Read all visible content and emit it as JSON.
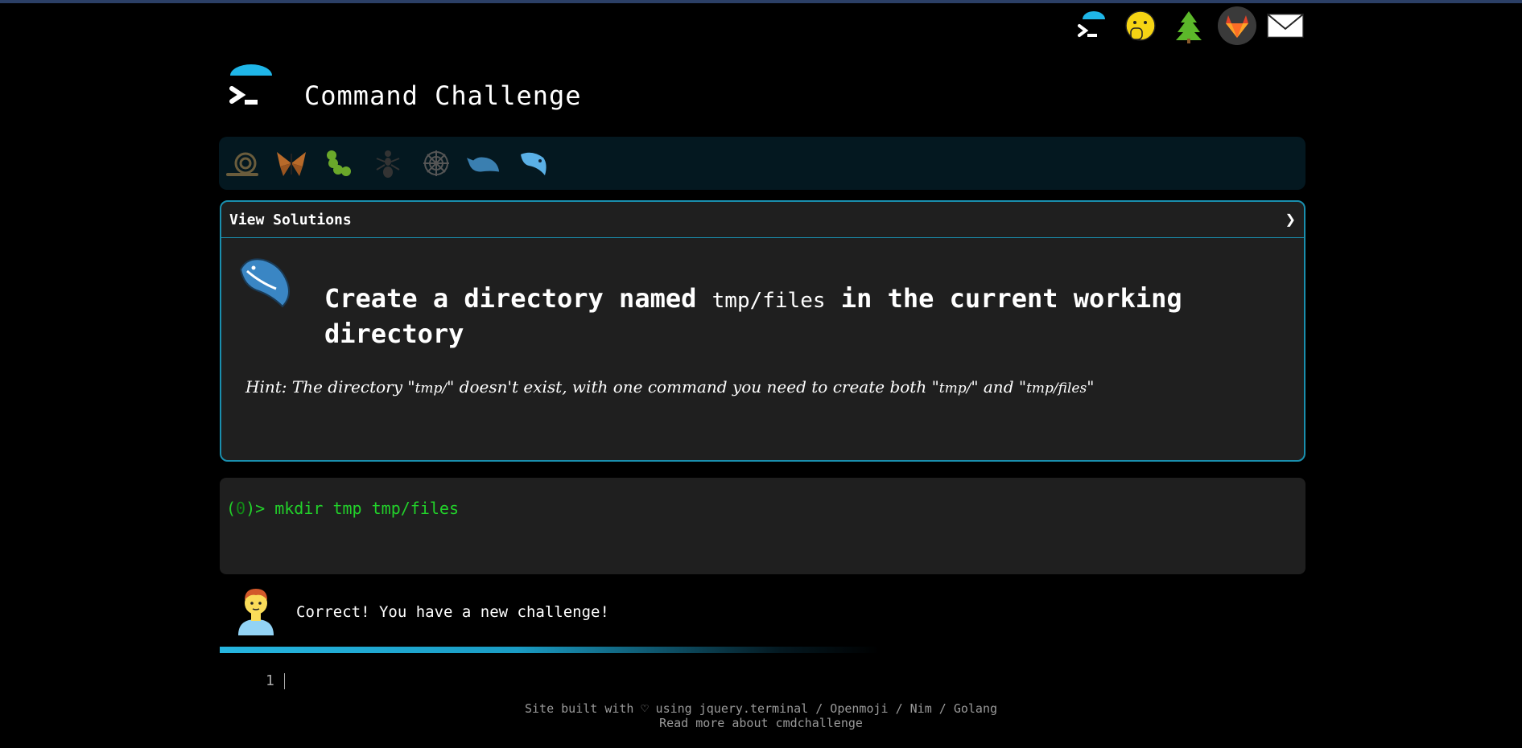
{
  "app": {
    "title": "Command Challenge"
  },
  "top_icons": [
    "terminal-icon",
    "shush-face-icon",
    "tree-icon",
    "gitlab-icon",
    "mail-icon"
  ],
  "levels": [
    "snail-icon",
    "butterfly-icon",
    "caterpillar-icon",
    "ant-icon",
    "spiderweb-icon",
    "whale-icon",
    "dolphin-icon"
  ],
  "panel": {
    "header": "View Solutions",
    "chevron": "❯",
    "title_pre": "Create a directory named ",
    "title_code": "tmp/files",
    "title_post": " in the current working directory",
    "hint_pre": "Hint: The directory \"",
    "hint_code1": "tmp/",
    "hint_mid": "\" doesn't exist, with one command you need to create both \"",
    "hint_code2": "tmp/",
    "hint_and": "\" and \"",
    "hint_code3": "tmp/files",
    "hint_end": "\""
  },
  "terminal": {
    "prompt_open": "(",
    "prompt_num": "0",
    "prompt_close": ")> ",
    "command": "mkdir tmp tmp/files"
  },
  "feedback": {
    "message": "Correct! You have a new challenge!"
  },
  "editor": {
    "line_number": "1"
  },
  "footer": {
    "line1": "Site built with ♡ using jquery.terminal / Openmoji / Nim / Golang",
    "line2": "Read more about cmdchallenge"
  },
  "colors": {
    "accent": "#1a8fae",
    "prompt": "#22d12a",
    "panel_bg": "#1f1f1f",
    "bar_bg": "#041820"
  }
}
